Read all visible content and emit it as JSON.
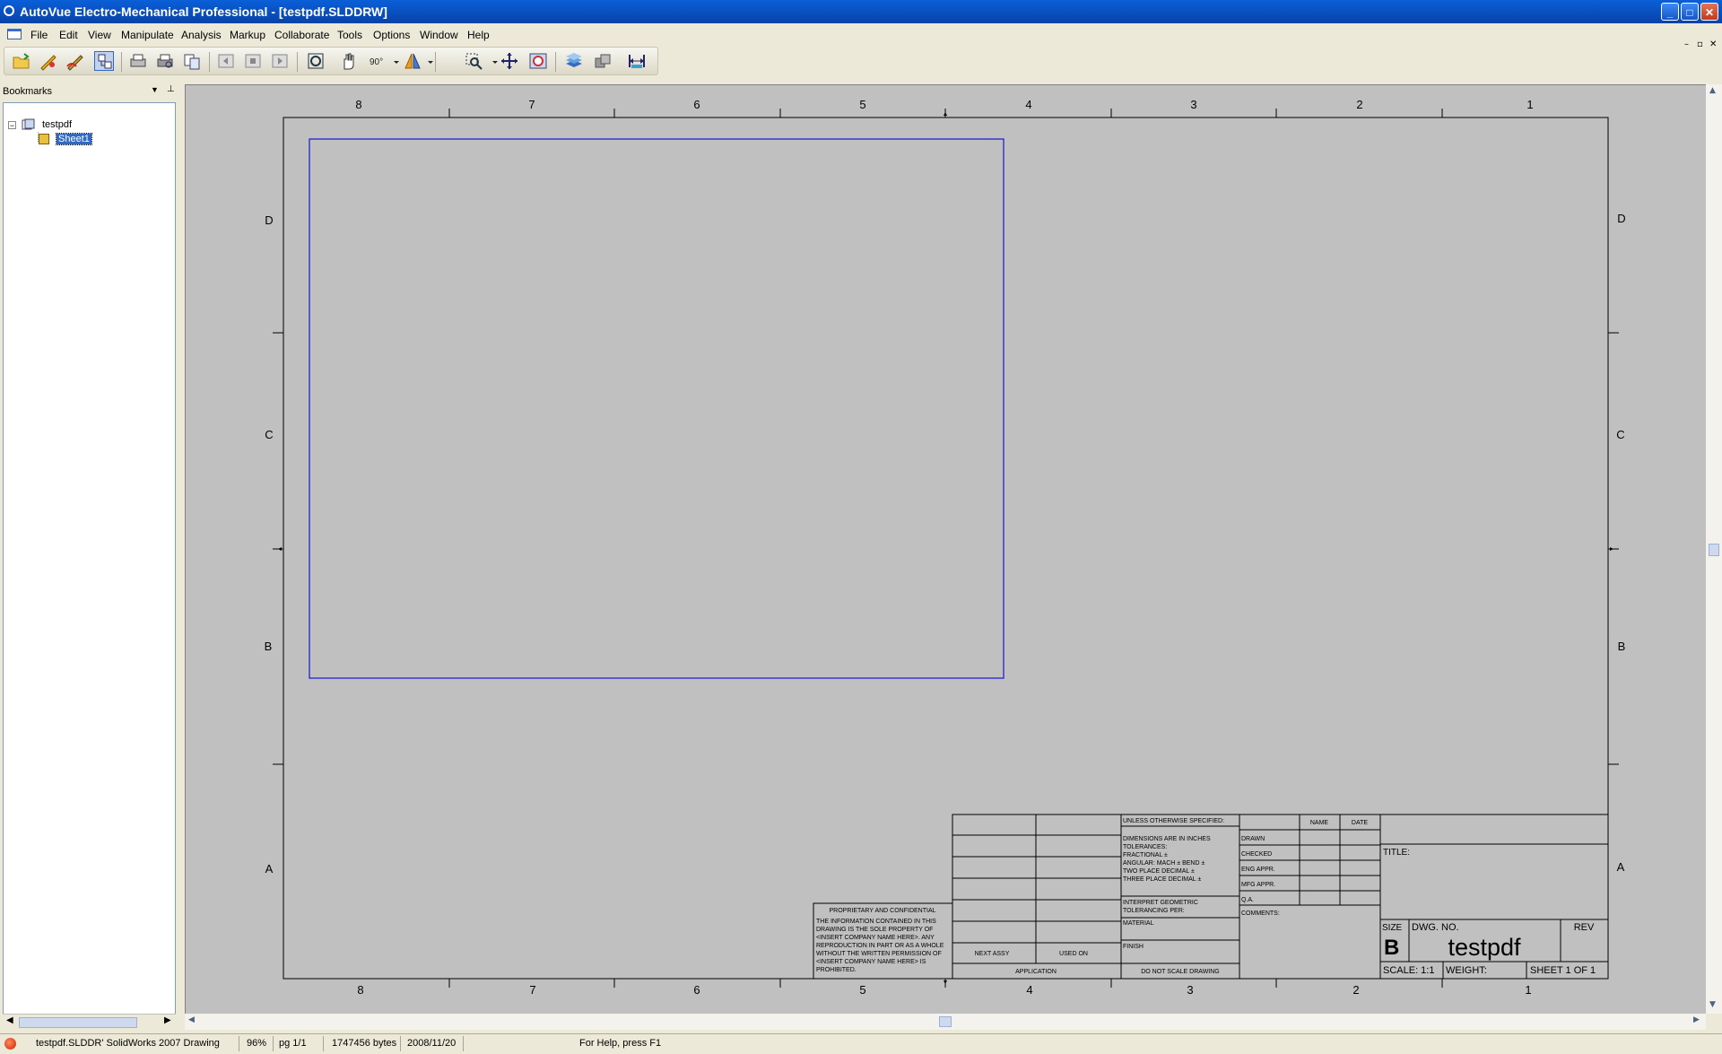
{
  "window": {
    "title": "AutoVue Electro-Mechanical Professional - [testpdf.SLDDRW]",
    "minimize": "_",
    "maximize": "□",
    "close": "✕"
  },
  "menu": {
    "items": [
      "File",
      "Edit",
      "View",
      "Manipulate",
      "Analysis",
      "Markup",
      "Collaborate",
      "Tools",
      "Options",
      "Window",
      "Help"
    ]
  },
  "mdi": {
    "minimize": "–",
    "restore": "▫",
    "close": "✕"
  },
  "bookmarks": {
    "title": "Bookmarks",
    "tree": {
      "root": "testpdf",
      "child": "Sheet1"
    }
  },
  "drawing": {
    "columns_top": [
      "8",
      "7",
      "6",
      "5",
      "4",
      "3",
      "2",
      "1"
    ],
    "columns_bottom": [
      "8",
      "7",
      "6",
      "5",
      "4",
      "3",
      "2",
      "1"
    ],
    "rows_left": [
      "D",
      "C",
      "B",
      "A"
    ],
    "rows_right": [
      "D",
      "C",
      "B",
      "A"
    ],
    "view_border_color": "#2222cc",
    "proprietary": {
      "heading": "PROPRIETARY AND CONFIDENTIAL",
      "lines": [
        "THE INFORMATION CONTAINED IN THIS",
        "DRAWING IS THE SOLE PROPERTY OF",
        "<INSERT COMPANY NAME HERE>. ANY",
        "REPRODUCTION IN PART OR AS A WHOLE",
        "WITHOUT THE WRITTEN PERMISSION OF",
        "<INSERT COMPANY NAME HERE> IS",
        "PROHIBITED."
      ]
    },
    "next_assy": "NEXT ASSY",
    "used_on": "USED ON",
    "application": "APPLICATION",
    "do_not_scale": "DO NOT SCALE DRAWING",
    "unless": "UNLESS OTHERWISE SPECIFIED:",
    "spec_lines": [
      "DIMENSIONS ARE IN INCHES",
      "TOLERANCES:",
      "FRACTIONAL ±",
      "ANGULAR: MACH ±    BEND ±",
      "TWO PLACE DECIMAL   ±",
      "THREE PLACE DECIMAL  ±"
    ],
    "interpret": [
      "INTERPRET GEOMETRIC",
      "TOLERANCING PER:"
    ],
    "material": "MATERIAL",
    "finish": "FINISH",
    "name_hdr": "NAME",
    "date_hdr": "DATE",
    "approvals": [
      "DRAWN",
      "CHECKED",
      "ENG APPR.",
      "MFG APPR.",
      "Q.A."
    ],
    "comments": "COMMENTS:",
    "title_label": "TITLE:",
    "size_label": "SIZE",
    "size_value": "B",
    "dwg_no_label": "DWG.  NO.",
    "dwg_no_value": "testpdf",
    "rev_label": "REV",
    "scale": "SCALE: 1:1",
    "weight": "WEIGHT:",
    "sheet": "SHEET 1 OF 1"
  },
  "status": {
    "file": "testpdf.SLDDR' SolidWorks 2007 Drawing",
    "zoom": "96%",
    "page": "pg 1/1",
    "size": "1747456 bytes",
    "date": "2008/11/20",
    "help": "For Help, press F1"
  }
}
